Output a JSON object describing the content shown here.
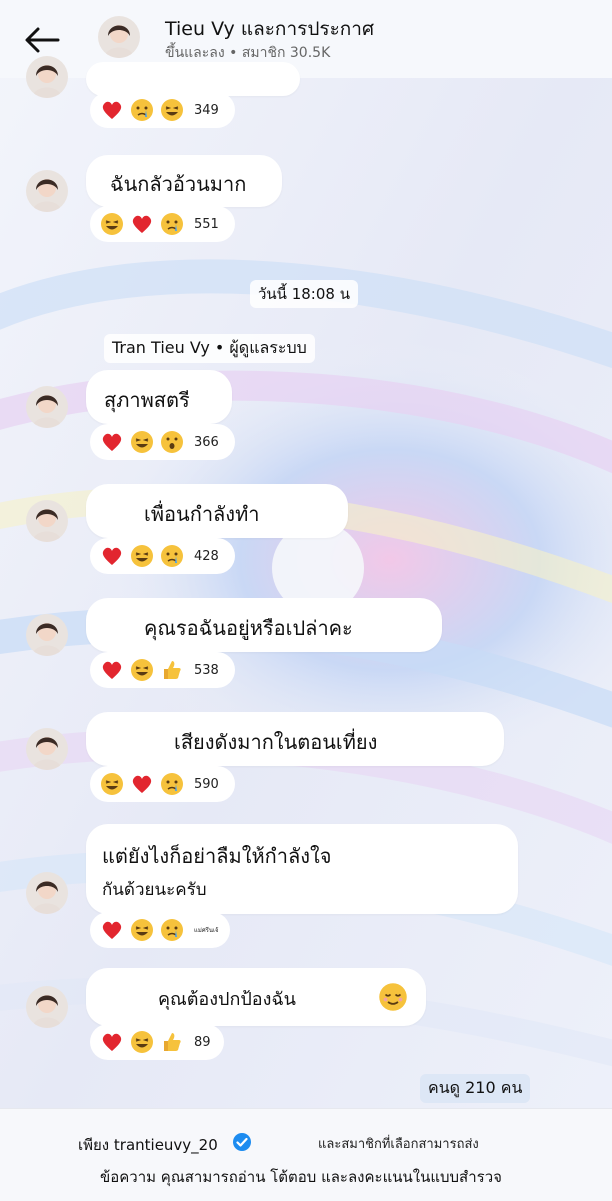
{
  "header": {
    "title": "Tieu Vy และการประกาศ",
    "subtitle": "ขึ้นและลง • สมาชิก 30.5K"
  },
  "timestamp": "วันนี้ 18:08 น",
  "sender": "Tran Tieu Vy • ผู้ดูแลระบบ",
  "messages": [
    {
      "text": "",
      "reactions": [
        "heart",
        "cry",
        "laugh"
      ],
      "count": "349"
    },
    {
      "text": "ฉันกลัวอ้วนมาก",
      "reactions": [
        "laugh",
        "heart",
        "cry"
      ],
      "count": "551"
    },
    {
      "text": "สุภาพสตรี",
      "reactions": [
        "heart",
        "laugh",
        "wow"
      ],
      "count": "366"
    },
    {
      "text": "เพื่อนกำลังทำ",
      "reactions": [
        "heart",
        "laugh",
        "cry"
      ],
      "count": "428"
    },
    {
      "text": "คุณรอฉันอยู่หรือเปล่าคะ",
      "reactions": [
        "heart",
        "laugh",
        "thumb"
      ],
      "count": "538"
    },
    {
      "text": "เสียงดังมากในตอนเที่ยง",
      "reactions": [
        "laugh",
        "heart",
        "cry"
      ],
      "count": "590"
    },
    {
      "text": "แต่ยังไงก็อย่าลืมให้กำลังใจ",
      "text2": "กันด้วยนะครับ",
      "reactions": [
        "heart",
        "laugh",
        "cry"
      ],
      "count": "แม่ศรีนเจ้"
    },
    {
      "text": "คุณต้องปกป้องฉัน",
      "emoji_icon": "relieved-face",
      "reactions": [
        "heart",
        "laugh",
        "thumb"
      ],
      "count": "89"
    }
  ],
  "viewers": "คนดู 210 คน",
  "footer": {
    "line1_user": "เพียง trantieuvy_20",
    "line1_rest": "และสมาชิกที่เลือกสามารถส่ง",
    "line2": "ข้อความ คุณสามารถอ่าน โต้ตอบ และลงคะแนนในแบบสำรวจ"
  },
  "colors": {
    "accent": "#1d8cf0",
    "heart": "#e2262f",
    "emoji": "#f6c23c"
  },
  "icons": [
    "back-arrow-icon",
    "verified-badge-icon",
    "relieved-face-icon"
  ]
}
